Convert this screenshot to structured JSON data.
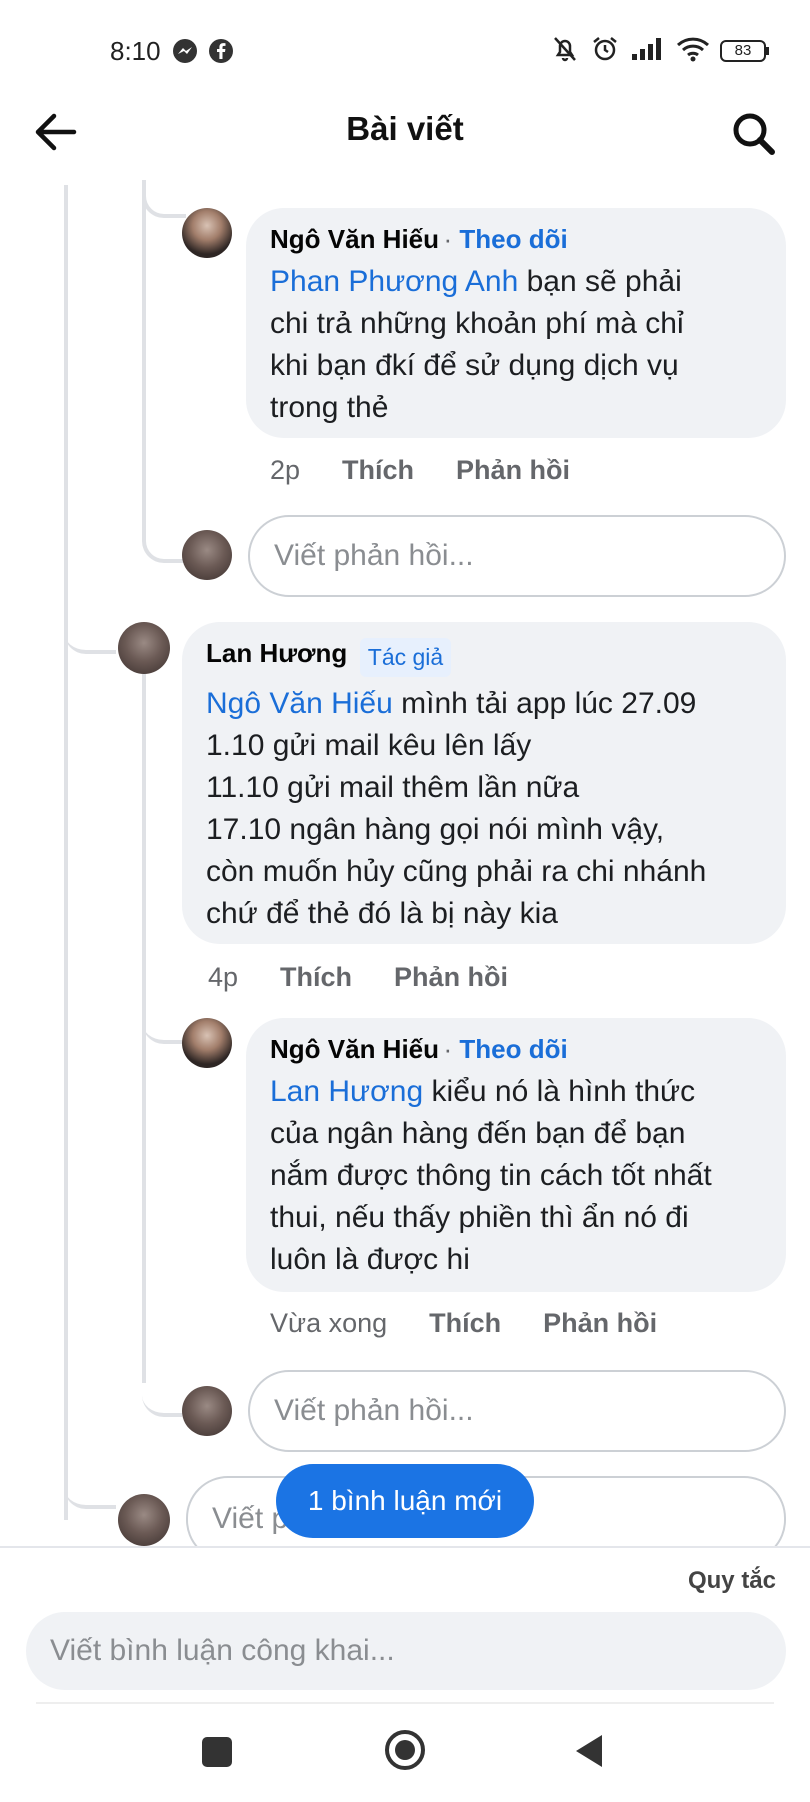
{
  "status": {
    "time": "8:10",
    "battery": "83"
  },
  "header": {
    "title": "Bài viết"
  },
  "comments": [
    {
      "name": "Ngô Văn Hiếu",
      "follow": "Theo dõi",
      "mention": "Phan Phương Anh",
      "text": " bạn sẽ phải\nchi trả những khoản phí mà chỉ\nkhi bạn đkí để sử dụng dịch vụ\ntrong thẻ",
      "time": "2p",
      "like": "Thích",
      "reply": "Phản hồi"
    },
    {
      "name": "Lan Hương",
      "badge": "Tác giả",
      "mention": "Ngô Văn Hiếu",
      "text": " mình tải app lúc 27.09\n1.10  gửi mail kêu lên lấy\n11.10 gửi mail thêm lần nữa\n17.10 ngân hàng gọi nói mình vậy,\ncòn muốn hủy cũng phải ra chi nhánh\nchứ để thẻ đó là bị này kia",
      "time": "4p",
      "like": "Thích",
      "reply": "Phản hồi"
    },
    {
      "name": "Ngô Văn Hiếu",
      "follow": "Theo dõi",
      "mention": "Lan Hương",
      "text": " kiểu nó là hình thức\ncủa ngân hàng đến bạn để bạn\nnắm được thông tin cách tốt nhất\nthui, nếu thấy phiền thì ẩn nó đi\nluôn là được hi",
      "time": "Vừa xong",
      "like": "Thích",
      "reply": "Phản hồi"
    }
  ],
  "reply_placeholder": "Viết phản hồi...",
  "reply_placeholder_partial": "Viết p",
  "new_comment_pill": "1 bình luận mới",
  "footer": {
    "rules": "Quy tắc",
    "public_placeholder": "Viết bình luận công khai..."
  },
  "colors": {
    "accent": "#1b74e4",
    "bubble": "#f0f2f5",
    "link": "#1a6ed8"
  },
  "icons": [
    "back-arrow-icon",
    "search-icon",
    "messenger-icon",
    "facebook-icon",
    "bell-off-icon",
    "alarm-icon",
    "signal-icon",
    "wifi-icon",
    "battery-icon",
    "square-icon",
    "circle-home-icon",
    "triangle-back-icon"
  ]
}
